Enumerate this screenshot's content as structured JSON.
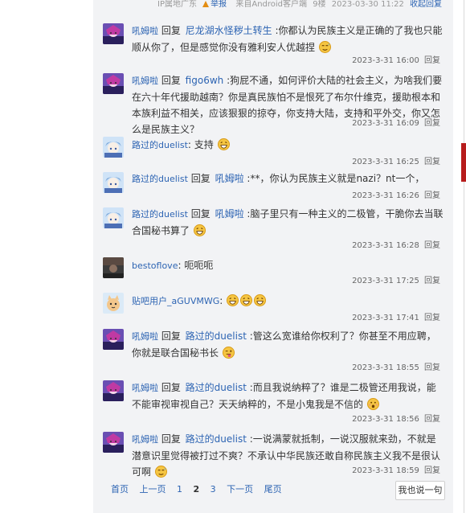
{
  "topbar": {
    "ip": "IP属地广东",
    "report": "举报",
    "source": "来自Android客户端",
    "floor": "9楼",
    "datetime": "2023-03-30 11:22",
    "fold": "收起回复"
  },
  "labels": {
    "reply_word": "回复",
    "reply_link": "回复"
  },
  "comments": [
    {
      "user": "吼姆啦",
      "target": "尼龙湖水怪秽土转生",
      "text": ":你都认为民族主义是正确的了我也只能顺从你了，但是感觉你没有雅利安人优越捏",
      "time": "2023-3-31 16:00",
      "avatar": "anime-purple"
    },
    {
      "user": "吼姆啦",
      "target": "figo6wh",
      "text": ":狗屁不通，如何评价大陆的社会主义，为啥我们要在六十年代援助越南？你是真民族怕不是恨死了布尔什维克，援助根本和本族利益不相关，应该狠狠的掠夺，你支持大陆，支持和平外交，你又怎么是民族主义？",
      "time": "2023-3-31 16:09",
      "avatar": "anime-purple"
    },
    {
      "user": "路过的duelist",
      "text": ": 支持",
      "time": "2023-3-31 16:25",
      "avatar": "anime-blue"
    },
    {
      "user": "路过的duelist",
      "target": "吼姆啦",
      "text": ":**，你认为民族主义就是nazi？nt一个，",
      "time": "2023-3-31 16:26",
      "avatar": "anime-blue"
    },
    {
      "user": "路过的duelist",
      "target": "吼姆啦",
      "text": ":脑子里只有一种主义的二极管，干脆你去当联合国秘书算了",
      "time": "2023-3-31 16:28",
      "avatar": "anime-blue"
    },
    {
      "user": "bestoflove",
      "text": ": 呃呃呃",
      "time": "2023-3-31 17:25",
      "avatar": "dark"
    },
    {
      "user": "贴吧用户_aGUVMWG",
      "text": ":",
      "time": "2023-3-31 17:41",
      "avatar": "cat"
    },
    {
      "user": "吼姆啦",
      "target": "路过的duelist",
      "text": ":管这么宽谁给你权利了？你甚至不用应聘，你就是联合国秘书长",
      "time": "2023-3-31 18:55",
      "avatar": "anime-purple"
    },
    {
      "user": "吼姆啦",
      "target": "路过的duelist",
      "text": ":而且我说纳粹了？谁是二极管还用我说，能不能审视审视自己？天天纳粹的，不是小鬼我是不信的",
      "time": "2023-3-31 18:56",
      "avatar": "anime-purple"
    },
    {
      "user": "吼姆啦",
      "target": "路过的duelist",
      "text": ":一说满蒙就抵制，一说汉服就来劲，不就是潜意识里觉得被打过不爽？不承认中华民族还敢自称民族主义我不是很认可啊",
      "time": "2023-3-31 18:59",
      "avatar": "anime-purple"
    }
  ],
  "pager": {
    "first": "首页",
    "prev": "上一页",
    "p1": "1",
    "p2": "2",
    "p3": "3",
    "next": "下一页",
    "last": "尾页"
  },
  "say_button": "我也说一句",
  "colors": {
    "link": "#2d64b3",
    "panel": "#f2f3f5",
    "accent": "#b71c1c"
  }
}
